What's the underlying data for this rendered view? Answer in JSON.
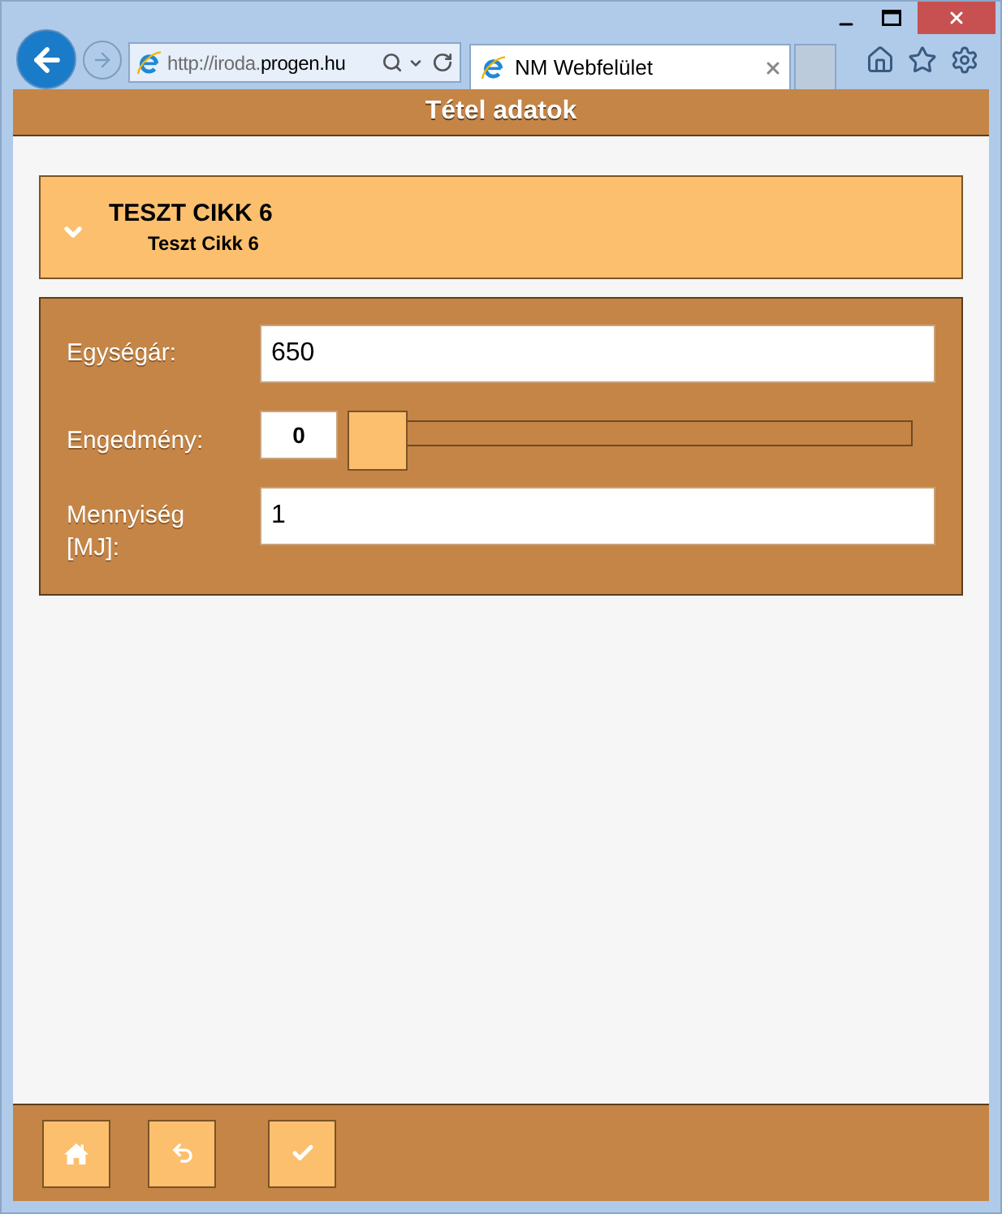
{
  "browser": {
    "address_bar": {
      "scheme_and_subdomain": "http://iroda.",
      "domain": "progen.hu"
    },
    "tab": {
      "title": "NM Webfelület"
    }
  },
  "header": {
    "title": "Tétel adatok"
  },
  "item": {
    "title": "TESZT CIKK 6",
    "subtitle": "Teszt Cikk 6"
  },
  "form": {
    "fields": [
      {
        "kind": "text",
        "label": "Egységár:",
        "value": "650"
      },
      {
        "kind": "slider",
        "label": "Engedmény:",
        "value": "0",
        "level": 0
      },
      {
        "kind": "text",
        "label": "Mennyiség [MJ]:",
        "value": "1"
      }
    ]
  },
  "footer": {
    "buttons": [
      {
        "kind": "home"
      },
      {
        "kind": "undo"
      },
      {
        "kind": "confirm"
      }
    ]
  }
}
